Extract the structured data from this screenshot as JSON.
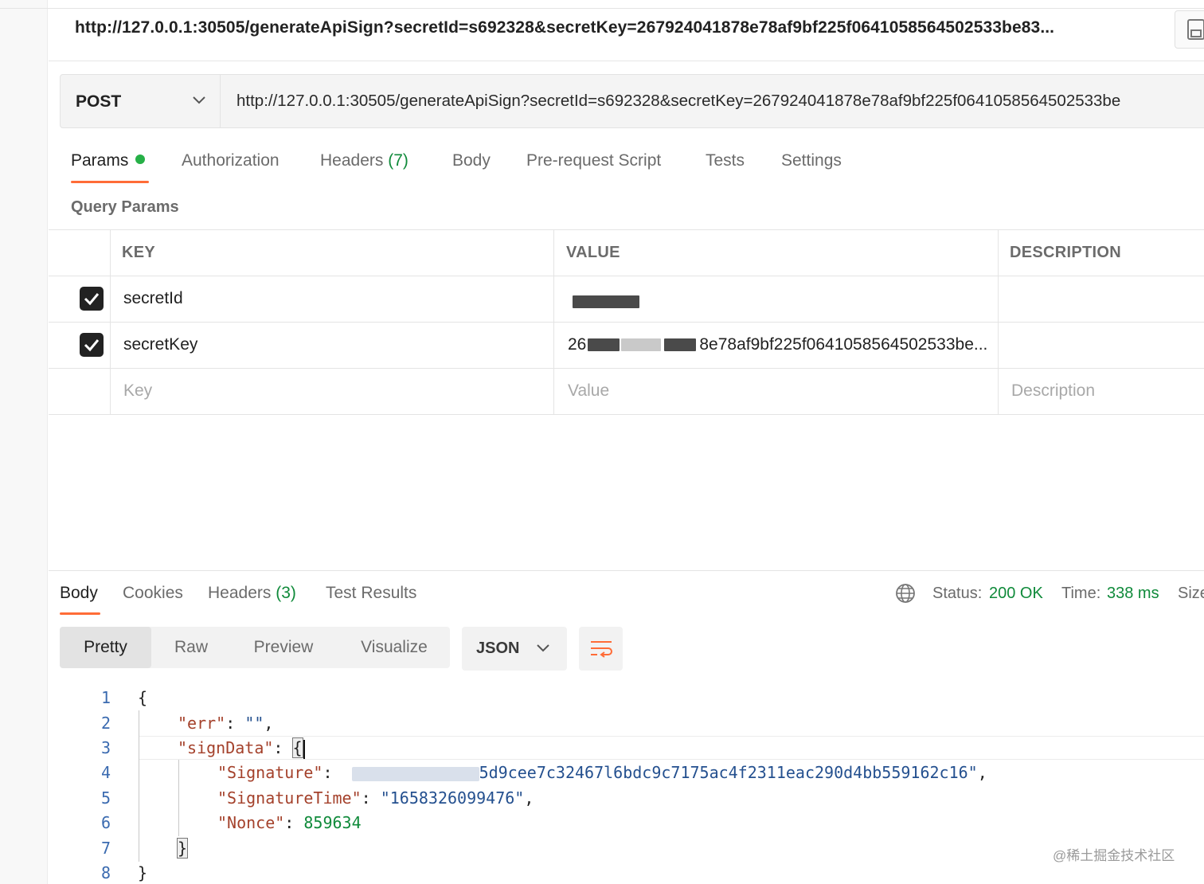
{
  "title": "http://127.0.0.1:30505/generateApiSign?secretId=s692328&secretKey=267924041878e78af9bf225f0641058564502533be83...",
  "request": {
    "method": "POST",
    "url": "http://127.0.0.1:30505/generateApiSign?secretId=s692328&secretKey=267924041878e78af9bf225f0641058564502533be"
  },
  "request_tabs": {
    "params": "Params",
    "authorization": "Authorization",
    "headers": "Headers",
    "headers_count": "(7)",
    "body": "Body",
    "pre_request": "Pre-request Script",
    "tests": "Tests",
    "settings": "Settings"
  },
  "query_params": {
    "label": "Query Params",
    "columns": {
      "key": "KEY",
      "value": "VALUE",
      "description": "DESCRIPTION"
    },
    "rows": [
      {
        "checked": true,
        "key": "secretId",
        "value": ""
      },
      {
        "checked": true,
        "key": "secretKey",
        "value_prefix": "26",
        "value_suffix": "8e78af9bf225f0641058564502533be..."
      }
    ],
    "placeholders": {
      "key": "Key",
      "value": "Value",
      "description": "Description"
    }
  },
  "response_tabs": {
    "body": "Body",
    "cookies": "Cookies",
    "headers": "Headers",
    "headers_count": "(3)",
    "test_results": "Test Results"
  },
  "status": {
    "status_label": "Status:",
    "status_value": "200 OK",
    "time_label": "Time:",
    "time_value": "338 ms",
    "size_label": "Size"
  },
  "view_modes": {
    "pretty": "Pretty",
    "raw": "Raw",
    "preview": "Preview",
    "visualize": "Visualize"
  },
  "format": "JSON",
  "code": {
    "line_numbers": [
      "1",
      "2",
      "3",
      "4",
      "5",
      "6",
      "7",
      "8"
    ],
    "open_brace": "{",
    "close_brace": "}",
    "err_key": "\"err\"",
    "err_value": "\"\"",
    "signdata_key": "\"signData\"",
    "signature_key": "\"Signature\"",
    "signature_value_visible": "5d9cee7c32467l6bdc9c7175ac4f2311eac290d4bb559162c16\"",
    "signaturetime_key": "\"SignatureTime\"",
    "signaturetime_value": "\"1658326099476\"",
    "nonce_key": "\"Nonce\"",
    "nonce_value": "859634"
  },
  "watermark": "@稀土掘金技术社区",
  "colors": {
    "accent": "#ff6c37",
    "success": "#0f8a3a",
    "json_key": "#a4412b",
    "json_string": "#24508f"
  }
}
